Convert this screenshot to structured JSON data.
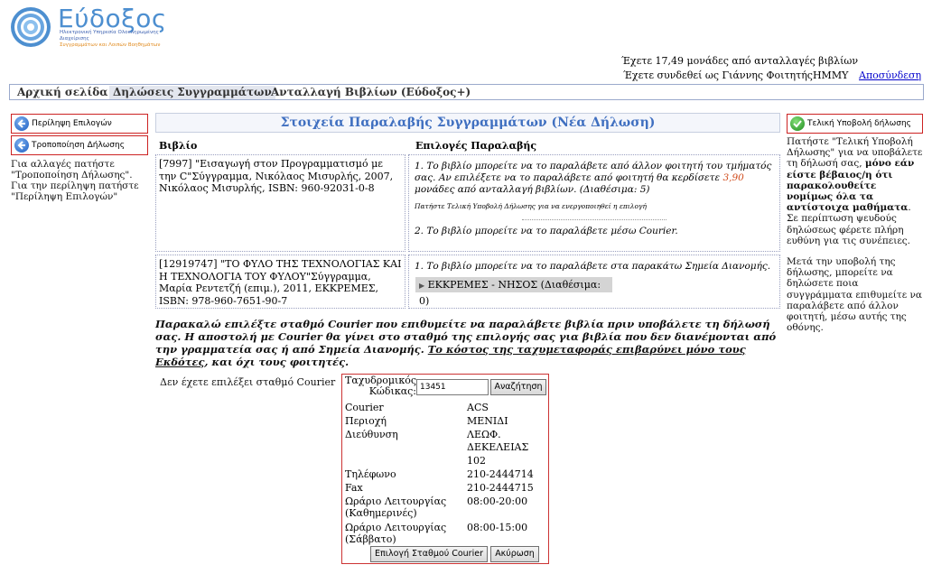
{
  "header": {
    "logo_title": "Εύδοξος",
    "logo_sub_line1": "Ηλεκτρονική Υπηρεσία Ολοκληρωμένης Διαχείρισης",
    "logo_sub_line2": "Συγγραμμάτων και Λοιπών Βοηθημάτων",
    "units_text": "Έχετε 17,49 μονάδες από ανταλλαγές βιβλίων",
    "login_text": "Έχετε συνδεθεί ως Γιάννης ΦοιτητήςΗΜΜΥ",
    "logout_label": "Αποσύνδεση"
  },
  "menu": {
    "home": "Αρχική σελίδα",
    "declarations": "Δηλώσεις Συγγραμμάτων",
    "exchange": "Ανταλλαγή Βιβλίων (Εύδοξος+)"
  },
  "left": {
    "summary_button": "Περίληψη Επιλογών",
    "modify_button": "Τροποποίηση Δήλωσης",
    "help_text": "Για αλλαγές πατήστε \"Τροποποίηση Δήλωσης\". Για την περίληψη πατήστε \"Περίληψη Επιλογών\""
  },
  "right": {
    "final_button": "Τελική Υποβολή δήλωσης",
    "help_part1": "Πατήστε \"Τελική Υποβολή Δήλωσης\" για να υποβάλετε τη δήλωσή σας,",
    "help_bold": "μόνο εάν είστε βέβαιος/η ότι παρακολουθείτε νομίμως όλα τα αντίστοιχα μαθήματα",
    "help_part2": ". Σε περίπτωση ψευδούς δηλώσεως φέρετε πλήρη ευθύνη για τις συνέπειες.",
    "help_part3": "Μετά την υποβολή της δήλωσης, μπορείτε να δηλώσετε ποια συγγράμματα επιθυμείτε να παραλάβετε από άλλον φοιτητή, μέσω αυτής της οθόνης."
  },
  "main": {
    "title": "Στοιχεία Παραλαβής Συγγραμμάτων (Νέα Δήλωση)",
    "col_book": "Βιβλίο",
    "col_options": "Επιλογές Παραλαβής",
    "rows": [
      {
        "book": "[7997] \"Εισαγωγή στον Προγραμματισμό με την C\"Σύγγραμμα, Νικόλαος Μισυρλής, 2007, Νικόλαος Μισυρλής, ISBN: 960-92031-0-8",
        "option1_a": "1. Το βιβλίο μπορείτε να το παραλάβετε από άλλον φοιτητή του τμήματός σας. Αν επιλέξετε να το παραλάβετε από φοιτητή θα κερδίσετε",
        "option1_units": "3,90",
        "option1_b": "μονάδες από ανταλλαγή βιβλίων. (Διαθέσιμα: 5)",
        "option1_note": "Πατήστε Τελική Υποβολή Δήλωσης για να ενεργοποιηθεί η επιλογή",
        "option2": "2. Το βιβλίο μπορείτε να το παραλάβετε μέσω Courier."
      },
      {
        "book": "[12919747] \"ΤΟ ΦΥΛΟ ΤΗΣ ΤΕΧΝΟΛΟΓΙΑΣ ΚΑΙ Η ΤΕΧΝΟΛΟΓΙΑ ΤΟΥ ΦΥΛΟΥ\"Σύγγραμμα, Μαρία Ρεντετζή (επιμ.), 2011, ΕΚΚΡΕΜΕΣ, ISBN: 978-960-7651-90-7",
        "option1": "1. Το βιβλίο μπορείτε να το παραλάβετε στα παρακάτω Σημεία Διανομής.",
        "pickup_point": "ΕΚΚΡΕΜΕΣ - ΝΗΣΟΣ (Διαθέσιμα: 0)"
      }
    ],
    "notice_part1": "Παρακαλώ επιλέξτε σταθμό Courier που επιθυμείτε να παραλάβετε βιβλία πριν υποβάλετε τη δήλωσή σας. Η αποστολή με Courier θα γίνει στο σταθμό της επιλογής σας για βιβλία που δεν διανέμονται από την γραμματεία σας ή από Σημεία Διανομής.",
    "notice_underlined": "Το κόστος της ταχυμεταφοράς επιβαρύνει μόνο τους Εκδότες",
    "notice_part2": ", και όχι τους φοιτητές.",
    "no_courier_text": "Δεν έχετε επιλέξει σταθμό Courier"
  },
  "courier": {
    "zip_label": "Ταχυδρομικός Κώδικας:",
    "zip_value": "13451",
    "search_button": "Αναζήτηση",
    "courier_label": "Courier",
    "courier_value": "ACS",
    "area_label": "Περιοχή",
    "area_value": "ΜΕΝΙΔΙ",
    "address_label": "Διεύθυνση",
    "address_value_1": "ΛΕΩΦ.",
    "address_value_2": "ΔΕΚΕΛΕΙΑΣ",
    "address_value_3": "102",
    "phone_label": "Τηλέφωνο",
    "phone_value": "210-2444714",
    "fax_label": "Fax",
    "fax_value": "210-2444715",
    "hours_week_label_1": "Ωράριο Λειτουργίας",
    "hours_week_label_2": "(Καθημερινές)",
    "hours_week_value": "08:00-20:00",
    "hours_sat_label_1": "Ωράριο Λειτουργίας",
    "hours_sat_label_2": "(Σάββατο)",
    "hours_sat_value": "08:00-15:00",
    "select_button": "Επιλογή Σταθμού Courier",
    "cancel_button": "Ακύρωση"
  },
  "colors": {
    "accent_blue": "#3f6fc0",
    "border_red": "#cc2222",
    "units_orange": "#d04a1a"
  },
  "icons": [
    "eudoxus-logo",
    "back-arrow-icon",
    "checkmark-icon",
    "triangle-right-icon"
  ]
}
